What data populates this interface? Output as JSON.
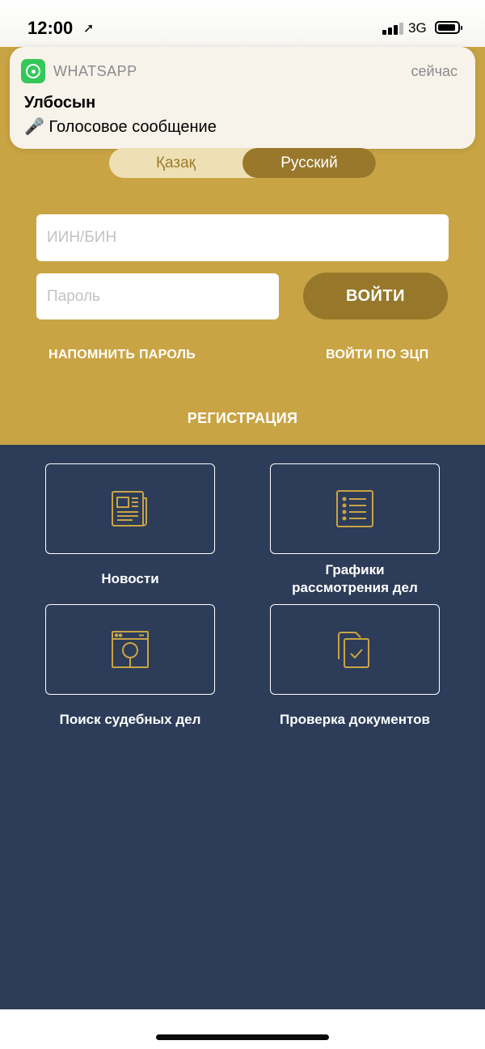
{
  "status_bar": {
    "time": "12:00",
    "location_icon": "location-arrow-icon",
    "network": "3G"
  },
  "notification": {
    "app_name": "WHATSAPP",
    "time": "сейчас",
    "sender": "Улбосын",
    "message": "🎤 Голосовое сообщение",
    "icon": "whatsapp-icon"
  },
  "language": {
    "options": [
      "Қазақ",
      "Русский"
    ],
    "selected": "Русский"
  },
  "login": {
    "iin_placeholder": "ИИН/БИН",
    "password_placeholder": "Пароль",
    "submit_label": "ВОЙТИ",
    "remind_password": "НАПОМНИТЬ ПАРОЛЬ",
    "ecp_login": "ВОЙТИ ПО ЭЦП",
    "register": "РЕГИСТРАЦИЯ"
  },
  "menu": {
    "items": [
      {
        "label": "Новости",
        "icon": "newspaper-icon"
      },
      {
        "label": "Графики\nрассмотрения дел",
        "icon": "list-icon"
      },
      {
        "label": "Поиск судебных дел",
        "icon": "search-archive-icon"
      },
      {
        "label": "Проверка документов",
        "icon": "document-check-icon"
      }
    ]
  },
  "colors": {
    "gold": "#c9a444",
    "gold_dark": "#97782b",
    "navy": "#2d3c58",
    "icon_gold": "#c9a444"
  }
}
